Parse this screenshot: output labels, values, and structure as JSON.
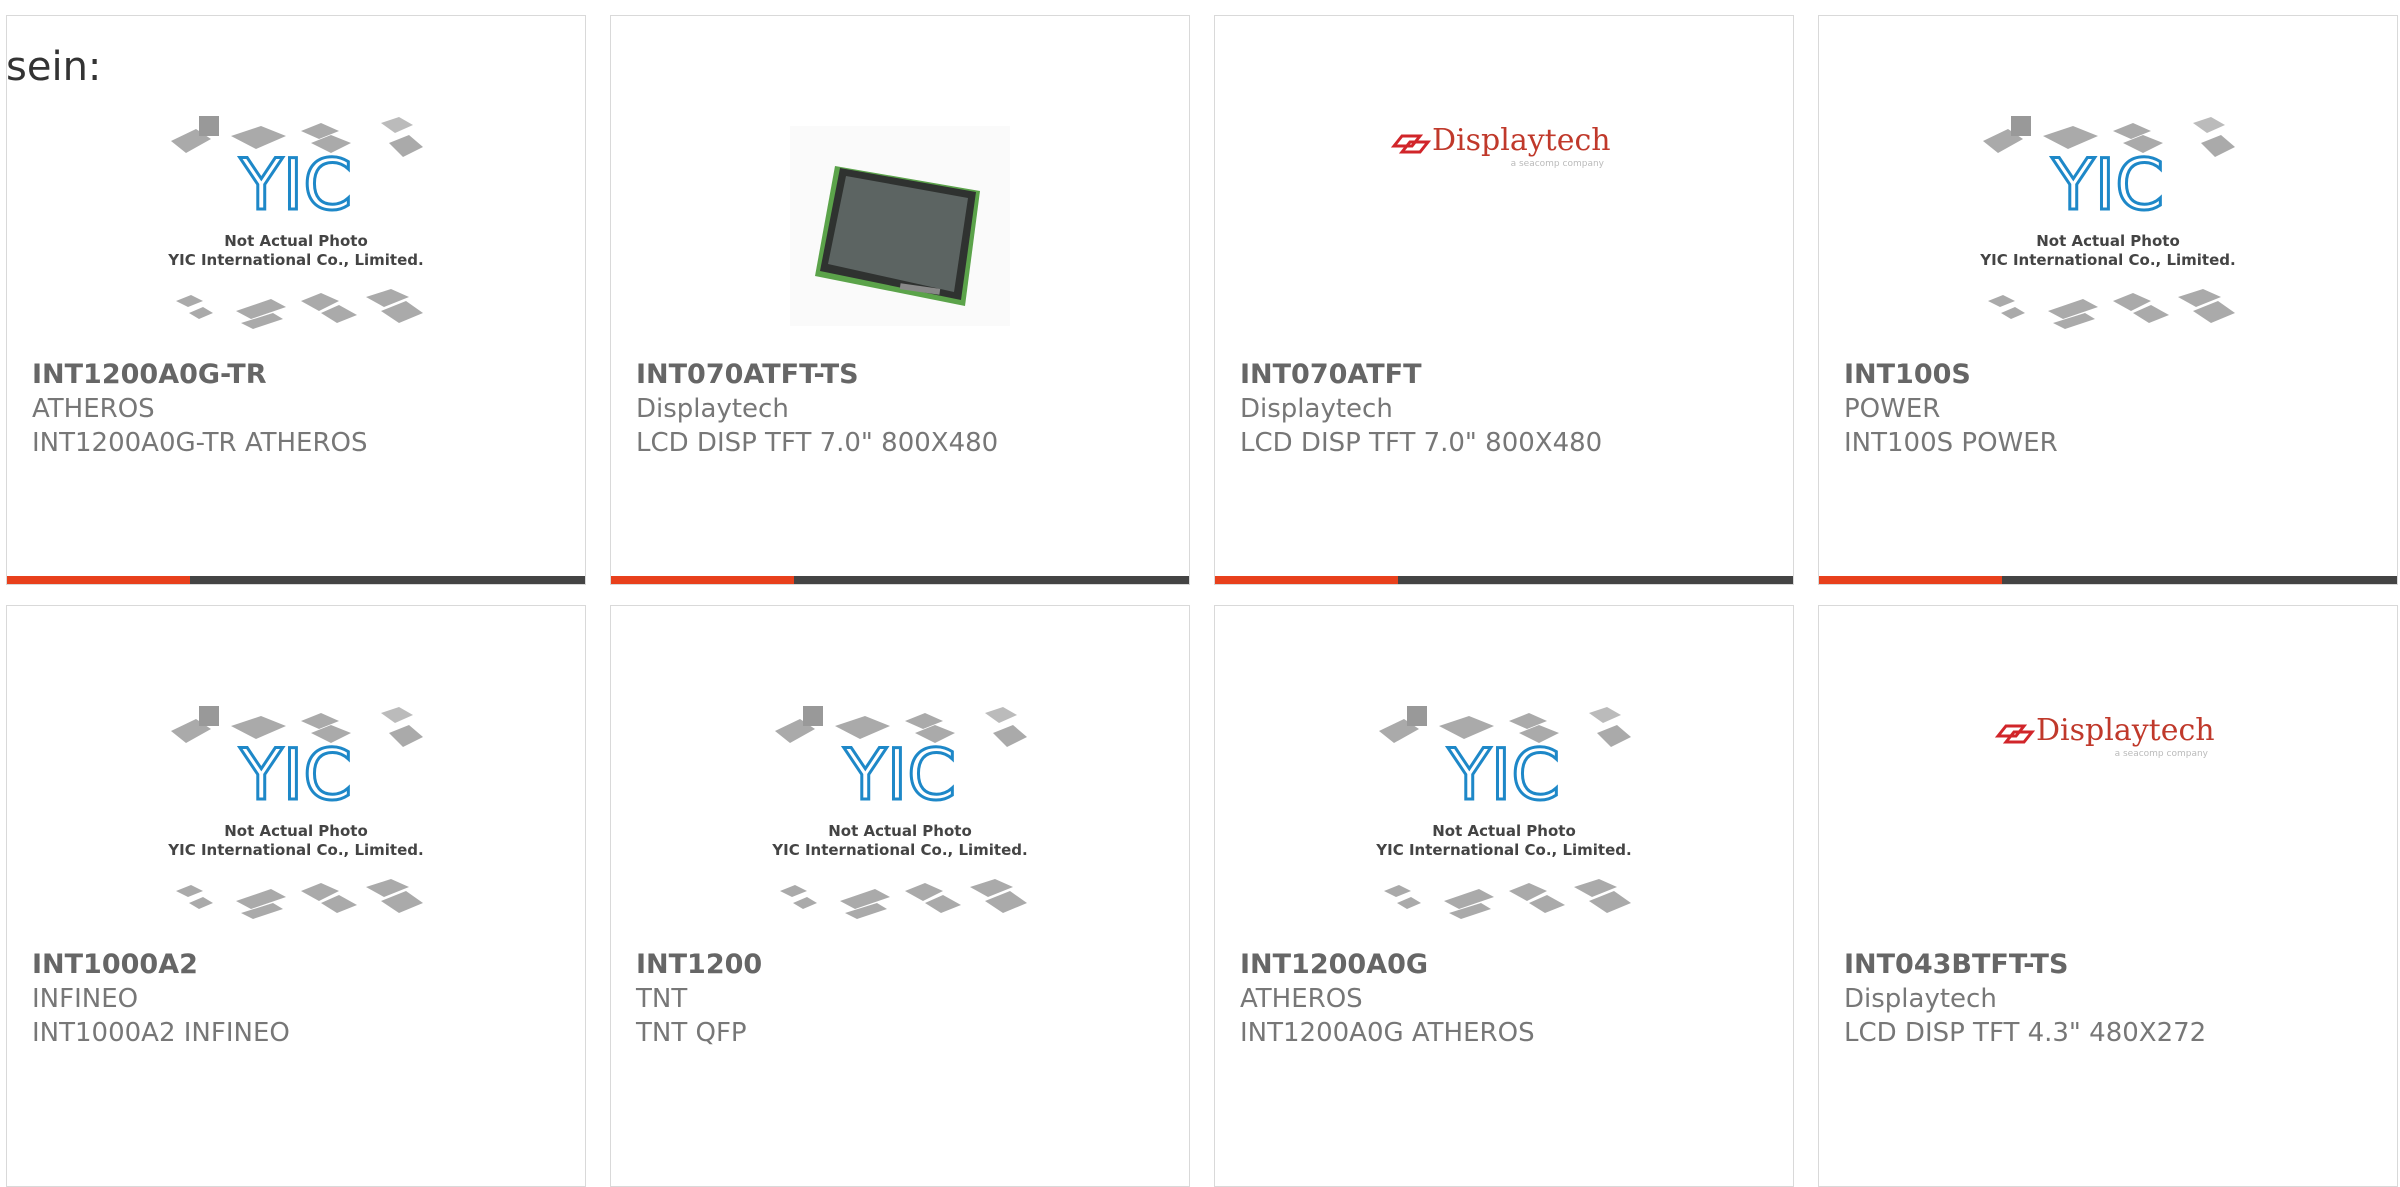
{
  "intro": "sein:",
  "placeholder_caption": {
    "line1": "Not Actual Photo",
    "line2": "YIC International Co., Limited."
  },
  "displaytech_logo": {
    "name": "Displaytech",
    "tagline": "a seacomp company"
  },
  "colors": {
    "accent": "#e8401c",
    "bar_dark": "#444444",
    "yic_blue": "#1e88c8",
    "displaytech_red": "#d1252a"
  },
  "products": [
    {
      "part": "INT1200A0G-TR",
      "maker": "ATHEROS",
      "desc": "INT1200A0G-TR ATHEROS",
      "image": "yic-placeholder"
    },
    {
      "part": "INT070ATFT-TS",
      "maker": "Displaytech",
      "desc": "LCD DISP TFT 7.0\" 800X480",
      "image": "lcd-panel-photo"
    },
    {
      "part": "INT070ATFT",
      "maker": "Displaytech",
      "desc": "LCD DISP TFT 7.0\" 800X480",
      "image": "displaytech-logo"
    },
    {
      "part": "INT100S",
      "maker": "POWER",
      "desc": "INT100S POWER",
      "image": "yic-placeholder"
    },
    {
      "part": "INT1000A2",
      "maker": "INFINEO",
      "desc": "INT1000A2 INFINEO",
      "image": "yic-placeholder"
    },
    {
      "part": "INT1200",
      "maker": "TNT",
      "desc": "TNT QFP",
      "image": "yic-placeholder"
    },
    {
      "part": "INT1200A0G",
      "maker": "ATHEROS",
      "desc": "INT1200A0G ATHEROS",
      "image": "yic-placeholder"
    },
    {
      "part": "INT043BTFT-TS",
      "maker": "Displaytech",
      "desc": "LCD DISP TFT 4.3\" 480X272",
      "image": "displaytech-logo"
    }
  ]
}
